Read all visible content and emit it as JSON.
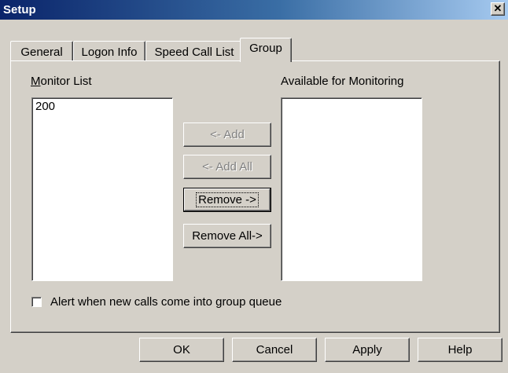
{
  "window": {
    "title": "Setup"
  },
  "tabs": [
    "General",
    "Logon Info",
    "Speed Call List",
    "Group"
  ],
  "monitor_list": {
    "label": "Monitor List",
    "items": [
      "200"
    ]
  },
  "available": {
    "label": "Available for Monitoring",
    "items": []
  },
  "mid_buttons": {
    "add": "<- Add",
    "add_all": "<- Add All",
    "remove": "Remove ->",
    "remove_all": "Remove All->"
  },
  "alert_checkbox": {
    "label": "Alert when new calls come into group queue",
    "checked": false
  },
  "footer_buttons": {
    "ok": "OK",
    "cancel": "Cancel",
    "apply": "Apply",
    "help": "Help"
  },
  "icons": {
    "close": "close-icon"
  }
}
